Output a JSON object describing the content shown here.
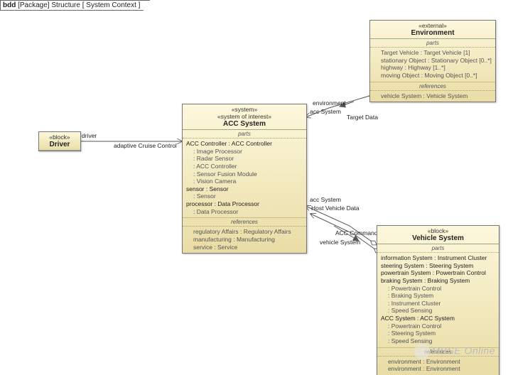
{
  "title": {
    "prefix": "bdd",
    "pkg_label": "[Package]",
    "name": "Structure",
    "context": "[ System Context ]"
  },
  "driver": {
    "stereo": "«block»",
    "name": "Driver"
  },
  "environment": {
    "stereo": "«external»",
    "name": "Environment",
    "parts_label": "parts",
    "parts": [
      "Target Vehicle : Target Vehicle [1]",
      "stationary Object : Stationary Object [0..*]",
      "highway : Highway [1..*]",
      "moving Object : Moving Object [0..*]"
    ],
    "refs_label": "references",
    "refs": [
      "vehicle System : Vehicle System"
    ]
  },
  "acc": {
    "stereo1": "«system»",
    "stereo2": "«system of interest»",
    "name": "ACC System",
    "parts_label": "parts",
    "parts": [
      {
        "text": "ACC Controller : ACC Controller"
      },
      {
        "text": ": Image Processor",
        "sub": true
      },
      {
        "text": ": Radar Sensor",
        "sub": true
      },
      {
        "text": ": ACC Controller",
        "sub": true
      },
      {
        "text": ": Sensor Fusion Module",
        "sub": true
      },
      {
        "text": ": Vision Camera",
        "sub": true
      },
      {
        "text": "sensor : Sensor"
      },
      {
        "text": ": Sensor",
        "sub": true
      },
      {
        "text": "processor : Data Processor"
      },
      {
        "text": ": Data Processor",
        "sub": true
      }
    ],
    "refs_label": "references",
    "refs": [
      "regulatory Affairs : Regulatory Affairs",
      "manufacturing : Manufacturing",
      "service : Service"
    ]
  },
  "vehicle": {
    "stereo": "«block»",
    "name": "Vehicle System",
    "parts_label": "parts",
    "parts": [
      {
        "text": "information System : Instrument Cluster"
      },
      {
        "text": "steering System : Steering System"
      },
      {
        "text": "powertrain System : Powertrain Control"
      },
      {
        "text": "braking System : Braking System"
      },
      {
        "text": ": Powertrain Control",
        "sub": true
      },
      {
        "text": ": Braking System",
        "sub": true
      },
      {
        "text": ": Instrument Cluster",
        "sub": true
      },
      {
        "text": ": Speed Sensing",
        "sub": true
      },
      {
        "text": "ACC System : ACC System"
      },
      {
        "text": ": Powertrain Control",
        "sub": true
      },
      {
        "text": ": Steering System",
        "sub": true
      },
      {
        "text": ": Speed Sensing",
        "sub": true
      }
    ],
    "refs_label": "references",
    "refs": [
      "environment : Environment",
      "environment : Environment"
    ]
  },
  "edges": {
    "driver_end": "driver",
    "adaptiveCruise": "adaptive Cruise Control",
    "env_end": "environment",
    "accSystem_end": "acc System",
    "targetData": "Target Data",
    "accSystem_end2": "acc System",
    "hostVehicleData": "Host Vehicle Data",
    "accCommands": "ACC Commands",
    "vehicleSystem_end": "vehicle System"
  },
  "watermark": "iMBSE Online"
}
